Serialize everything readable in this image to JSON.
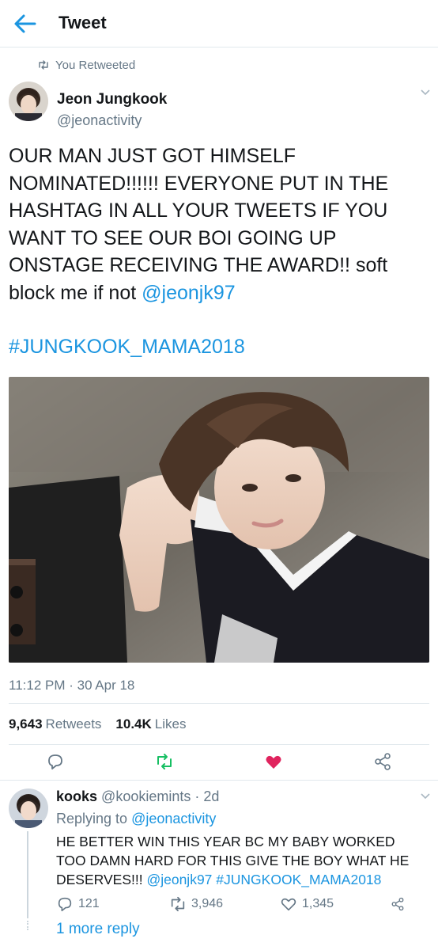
{
  "header": {
    "title": "Tweet"
  },
  "retweet_note": {
    "text": "You Retweeted"
  },
  "tweet": {
    "author_name": "Jeon Jungkook",
    "author_handle": "@jeonactivity",
    "text_lines": [
      "OUR MAN JUST GOT HIMSELF",
      "NOMINATED!!!!!! EVERYONE PUT IN THE",
      "HASHTAG IN ALL YOUR TWEETS IF YOU",
      "WANT TO SEE OUR BOI GOING UP",
      "ONSTAGE RECEIVING THE AWARD!! soft",
      "block me if not "
    ],
    "mention": "@jeonjk97",
    "hashtag": "#JUNGKOOK_MAMA2018",
    "timestamp": "11:12 PM · 30 Apr 18",
    "retweets_count": "9,643",
    "retweets_label": "Retweets",
    "likes_count": "10.4K",
    "likes_label": "Likes",
    "liked": true,
    "retweeted": true
  },
  "reply": {
    "name": "kooks",
    "handle_time": "@kookiemints · 2d",
    "replying_prefix": "Replying to ",
    "replying_to": "@jeonactivity",
    "text": "HE BETTER WIN THIS YEAR BC MY BABY WORKED TOO DAMN HARD FOR THIS GIVE THE BOY WHAT HE DESERVES!!! ",
    "mention": "@jeonjk97",
    "hashtag": "#JUNGKOOK_MAMA2018",
    "reply_count": "121",
    "retweet_count": "3,946",
    "like_count": "1,345",
    "more_replies": "1 more reply"
  },
  "colors": {
    "accent": "#1b95e0",
    "retweet_green": "#17bf63",
    "like_red": "#e0245e",
    "secondary_text": "#657786"
  },
  "icons": {
    "back": "arrow-left-icon",
    "retweet": "retweet-icon",
    "reply": "reply-icon",
    "like": "heart-icon",
    "share": "share-icon",
    "more": "chevron-down-icon"
  }
}
